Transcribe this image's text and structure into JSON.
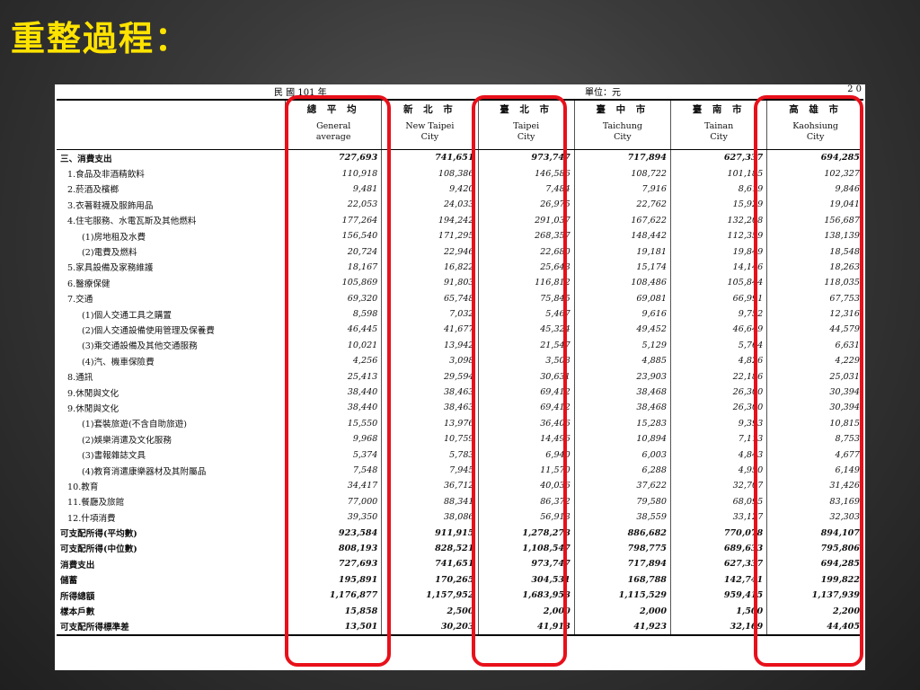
{
  "slide": {
    "title": "重整過程："
  },
  "table": {
    "topline": {
      "year_label": "民 國  101  年",
      "unit_label": "單位：元",
      "page_label": "2 0"
    },
    "columns": [
      {
        "cn": "總 平 均",
        "en1": "General",
        "en2": "average"
      },
      {
        "cn": "新 北 市",
        "en1": "New Taipei",
        "en2": "City"
      },
      {
        "cn": "臺 北 市",
        "en1": "Taipei",
        "en2": "City"
      },
      {
        "cn": "臺 中 市",
        "en1": "Taichung",
        "en2": "City"
      },
      {
        "cn": "臺 南 市",
        "en1": "Tainan",
        "en2": "City"
      },
      {
        "cn": "高 雄 市",
        "en1": "Kaohsiung",
        "en2": "City"
      }
    ],
    "rows": [
      {
        "label": "三、消費支出",
        "indent": 0,
        "bold": true,
        "values": [
          "727,693",
          "741,651",
          "973,747",
          "717,894",
          "627,337",
          "694,285"
        ]
      },
      {
        "label": "1.食品及非酒精飲料",
        "indent": 1,
        "values": [
          "110,918",
          "108,386",
          "146,586",
          "108,722",
          "101,185",
          "102,327"
        ]
      },
      {
        "label": "2.菸酒及檳榔",
        "indent": 1,
        "values": [
          "9,481",
          "9,420",
          "7,484",
          "7,916",
          "8,619",
          "9,846"
        ]
      },
      {
        "label": "3.衣著鞋襪及服飾用品",
        "indent": 1,
        "values": [
          "22,053",
          "24,033",
          "26,975",
          "22,762",
          "15,929",
          "19,041"
        ]
      },
      {
        "label": "4.住宅服務、水電瓦斯及其他燃料",
        "indent": 1,
        "values": [
          "177,264",
          "194,242",
          "291,037",
          "167,622",
          "132,208",
          "156,687"
        ]
      },
      {
        "label": "(1)房地租及水費",
        "indent": 2,
        "values": [
          "156,540",
          "171,295",
          "268,357",
          "148,442",
          "112,359",
          "138,139"
        ]
      },
      {
        "label": "(2)電費及燃料",
        "indent": 2,
        "values": [
          "20,724",
          "22,946",
          "22,680",
          "19,181",
          "19,849",
          "18,548"
        ]
      },
      {
        "label": "5.家具設備及家務維護",
        "indent": 1,
        "gap": true,
        "values": [
          "18,167",
          "16,822",
          "25,643",
          "15,174",
          "14,146",
          "18,263"
        ]
      },
      {
        "label": "6.醫療保健",
        "indent": 1,
        "gap": true,
        "values": [
          "105,869",
          "91,803",
          "116,812",
          "108,486",
          "105,844",
          "118,035"
        ]
      },
      {
        "label": "7.交通",
        "indent": 1,
        "values": [
          "69,320",
          "65,748",
          "75,845",
          "69,081",
          "66,991",
          "67,753"
        ]
      },
      {
        "label": "(1)個人交通工具之購置",
        "indent": 2,
        "values": [
          "8,598",
          "7,032",
          "5,467",
          "9,616",
          "9,752",
          "12,316"
        ]
      },
      {
        "label": "(2)個人交通設備使用管理及保養費",
        "indent": 2,
        "values": [
          "46,445",
          "41,677",
          "45,324",
          "49,452",
          "46,649",
          "44,579"
        ]
      },
      {
        "label": "(3)乘交通設備及其他交通服務",
        "indent": 2,
        "values": [
          "10,021",
          "13,942",
          "21,547",
          "5,129",
          "5,764",
          "6,631"
        ]
      },
      {
        "label": "(4)汽、機車保險費",
        "indent": 2,
        "values": [
          "4,256",
          "3,098",
          "3,508",
          "4,885",
          "4,826",
          "4,229"
        ]
      },
      {
        "label": "8.通訊",
        "indent": 1,
        "values": [
          "25,413",
          "29,594",
          "30,631",
          "23,903",
          "22,186",
          "25,031"
        ]
      },
      {
        "label": "9.休閒與文化",
        "indent": 1,
        "values": [
          "38,440",
          "38,463",
          "69,412",
          "38,468",
          "26,300",
          "30,394"
        ]
      },
      {
        "label": "9.休閒與文化",
        "indent": 1,
        "gap": true,
        "values": [
          "38,440",
          "38,463",
          "69,412",
          "38,468",
          "26,300",
          "30,394"
        ]
      },
      {
        "label": "(1)套裝旅遊(不含自助旅遊)",
        "indent": 2,
        "values": [
          "15,550",
          "13,976",
          "36,406",
          "15,283",
          "9,393",
          "10,815"
        ]
      },
      {
        "label": "(2)娛樂消遣及文化服務",
        "indent": 2,
        "values": [
          "9,968",
          "10,759",
          "14,496",
          "10,894",
          "7,113",
          "8,753"
        ]
      },
      {
        "label": "(3)書報雜誌文具",
        "indent": 2,
        "values": [
          "5,374",
          "5,783",
          "6,940",
          "6,003",
          "4,843",
          "4,677"
        ]
      },
      {
        "label": "(4)教育消遣康樂器材及其附屬品",
        "indent": 2,
        "values": [
          "7,548",
          "7,945",
          "11,570",
          "6,288",
          "4,950",
          "6,149"
        ]
      },
      {
        "label": "10.教育",
        "indent": 1,
        "values": [
          "34,417",
          "36,712",
          "40,036",
          "37,622",
          "32,707",
          "31,426"
        ]
      },
      {
        "label": "11.餐廳及旅館",
        "indent": 1,
        "values": [
          "77,000",
          "88,341",
          "86,372",
          "79,580",
          "68,095",
          "83,169"
        ]
      },
      {
        "label": "12.什項消費",
        "indent": 1,
        "values": [
          "39,350",
          "38,086",
          "56,913",
          "38,559",
          "33,127",
          "32,303"
        ]
      },
      {
        "label": "可支配所得(平均數)",
        "indent": 0,
        "bold": true,
        "values": [
          "923,584",
          "911,915",
          "1,278,278",
          "886,682",
          "770,078",
          "894,107"
        ]
      },
      {
        "label": "可支配所得(中位數)",
        "indent": 0,
        "bold": true,
        "values": [
          "808,193",
          "828,521",
          "1,108,547",
          "798,775",
          "689,633",
          "795,806"
        ]
      },
      {
        "label": "消費支出",
        "indent": 0,
        "bold": true,
        "values": [
          "727,693",
          "741,651",
          "973,747",
          "717,894",
          "627,337",
          "694,285"
        ]
      },
      {
        "label": "儲蓄",
        "indent": 0,
        "bold": true,
        "values": [
          "195,891",
          "170,265",
          "304,531",
          "168,788",
          "142,741",
          "199,822"
        ]
      },
      {
        "label": "所得總額",
        "indent": 0,
        "bold": true,
        "values": [
          "1,176,877",
          "1,157,952",
          "1,683,958",
          "1,115,529",
          "959,415",
          "1,137,939"
        ]
      },
      {
        "label": "樣本戶數",
        "indent": 0,
        "bold": true,
        "values": [
          "15,858",
          "2,500",
          "2,000",
          "2,000",
          "1,500",
          "2,200"
        ]
      },
      {
        "label": "可支配所得標準差",
        "indent": 0,
        "bold": true,
        "last": true,
        "values": [
          "13,501",
          "30,203",
          "41,913",
          "41,923",
          "32,169",
          "44,405"
        ]
      }
    ],
    "highlighted_columns": [
      "總 平 均",
      "臺 北 市",
      "高 雄 市"
    ],
    "highlight_color": "#e8101a"
  }
}
